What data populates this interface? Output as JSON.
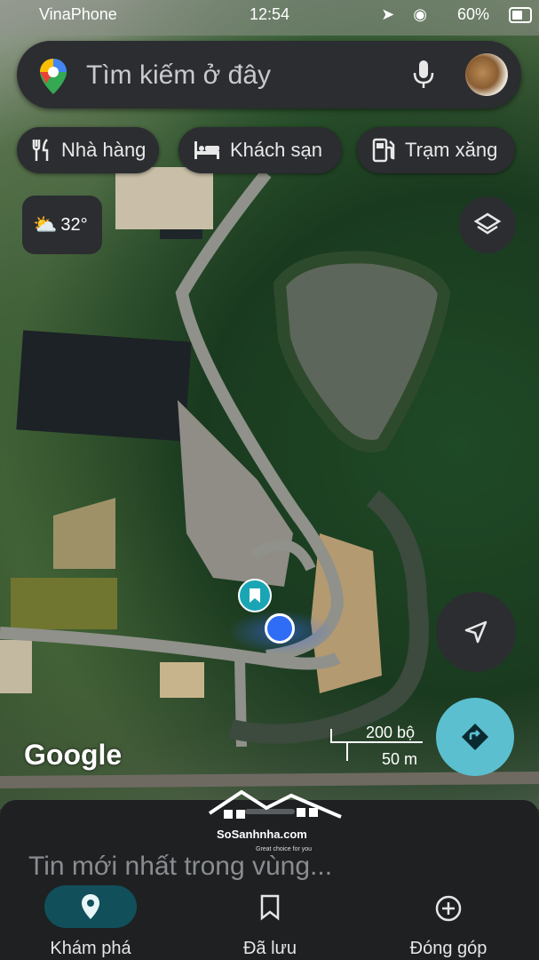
{
  "status_bar": {
    "carrier": "VinaPhone",
    "time": "12:54",
    "battery": "60%"
  },
  "search": {
    "placeholder": "Tìm kiếm ở đây",
    "icons": [
      "google-maps-pin-icon",
      "mic-icon",
      "avatar"
    ]
  },
  "chips": [
    {
      "label": "Nhà hàng",
      "icon": "restaurant-icon"
    },
    {
      "label": "Khách sạn",
      "icon": "hotel-icon"
    },
    {
      "label": "Trạm xăng",
      "icon": "gas-station-icon"
    }
  ],
  "weather": {
    "temperature": "32°",
    "icon": "partly-sunny-icon"
  },
  "map": {
    "logo": "Google",
    "scale_imperial": "200 bộ",
    "scale_metric": "50 m"
  },
  "watermark": {
    "name": "SoSanhnha.com",
    "slogan": "Great choice for you"
  },
  "sheet": {
    "title": "Tin mới nhất trong vùng..."
  },
  "tabs": [
    {
      "label": "Khám phá",
      "icon": "explore-pin-icon",
      "active": true
    },
    {
      "label": "Đã lưu",
      "icon": "bookmark-icon",
      "active": false
    },
    {
      "label": "Đóng góp",
      "icon": "add-circle-icon",
      "active": false
    }
  ],
  "colors": {
    "accent": "#5bbfd0",
    "active_pill": "#114f5a",
    "my_location": "#2f6df6",
    "surface": "#2b2d31"
  }
}
